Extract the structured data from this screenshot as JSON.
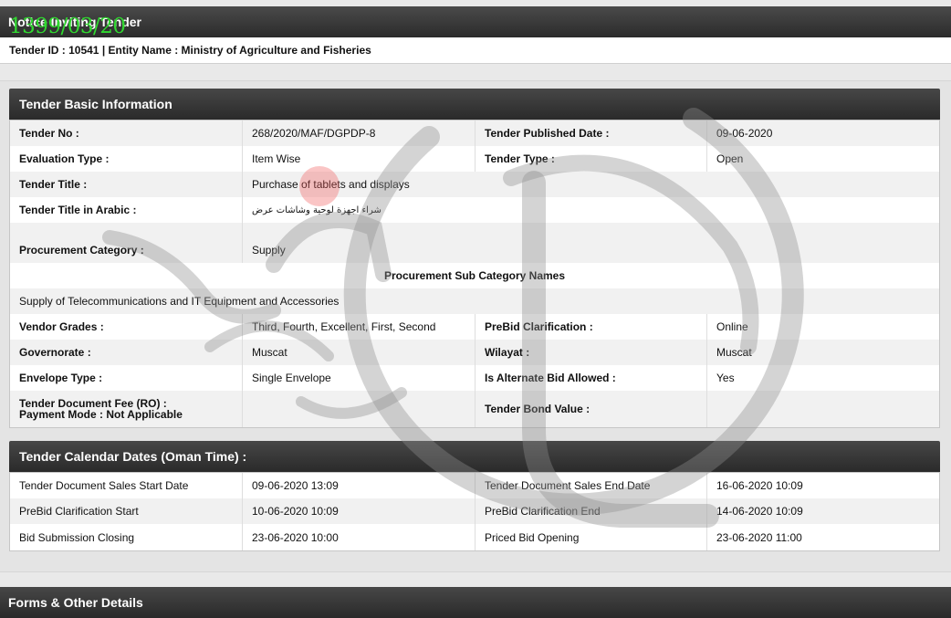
{
  "page": {
    "title": "Notice Inviting Tender",
    "stamp_text": "1399/03/20",
    "tender_id_line": "Tender ID : 10541 | Entity Name : Ministry of Agriculture and Fisheries"
  },
  "basic_info": {
    "header": "Tender Basic Information",
    "tender_no_label": "Tender No :",
    "tender_no": "268/2020/MAF/DGPDP-8",
    "published_label": "Tender Published Date :",
    "published": "09-06-2020",
    "eval_type_label": "Evaluation Type :",
    "eval_type": "Item Wise",
    "tender_type_label": "Tender Type :",
    "tender_type": "Open",
    "title_label": "Tender Title :",
    "title": "Purchase of tablets and displays",
    "title_ar_label": "Tender Title in Arabic :",
    "title_ar": "شراء اجهزة لوحية وشاشات عرض",
    "proc_cat_label": "Procurement Category :",
    "proc_cat": "Supply",
    "sub_cat_header": "Procurement Sub Category Names",
    "sub_cat": "Supply of Telecommunications and IT Equipment and Accessories",
    "vendor_label": "Vendor Grades :",
    "vendor": "Third, Fourth, Excellent, First, Second",
    "prebid_label": "PreBid Clarification :",
    "prebid": "Online",
    "gov_label": "Governorate :",
    "gov": "Muscat",
    "wilayat_label": "Wilayat :",
    "wilayat": "Muscat",
    "envelope_label": "Envelope Type :",
    "envelope": "Single Envelope",
    "alt_bid_label": "Is Alternate Bid Allowed :",
    "alt_bid": "Yes",
    "doc_fee_label": "Tender Document Fee (RO) :",
    "payment_mode_label": "Payment Mode : ",
    "payment_mode": "Not Applicable",
    "bond_label": "Tender Bond Value :",
    "bond": ""
  },
  "calendar": {
    "header": "Tender Calendar Dates (Oman Time) :",
    "rows": [
      {
        "l1": "Tender Document Sales Start Date",
        "v1": "09-06-2020 13:09",
        "l2": "Tender Document Sales End Date",
        "v2": "16-06-2020 10:09"
      },
      {
        "l1": "PreBid Clarification Start",
        "v1": "10-06-2020 10:09",
        "l2": "PreBid Clarification End",
        "v2": "14-06-2020 10:09"
      },
      {
        "l1": "Bid Submission Closing",
        "v1": "23-06-2020 10:00",
        "l2": "Priced Bid Opening",
        "v2": "23-06-2020 11:00"
      }
    ]
  },
  "forms": {
    "header": "Forms & Other Details"
  },
  "colors": {
    "header_dark": "#2a2a2a",
    "stamp_green": "#2fd82f",
    "alt_row": "#f1f1f1"
  }
}
